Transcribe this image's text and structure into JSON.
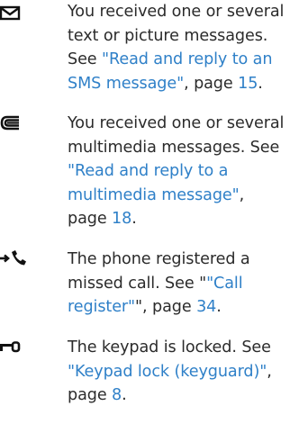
{
  "colors": {
    "text": "#2b2b2b",
    "link": "#2f80c8",
    "icon": "#111111"
  },
  "entries": [
    {
      "icon": "envelope-icon",
      "lines": [
        [
          {
            "t": "You received one or several",
            "k": "plain"
          }
        ],
        [
          {
            "t": "text or picture messages.",
            "k": "plain"
          }
        ],
        [
          {
            "t": "See ",
            "k": "plain"
          },
          {
            "t": "\"Read and reply to an",
            "k": "link"
          }
        ],
        [
          {
            "t": "SMS message\"",
            "k": "link"
          },
          {
            "t": ", page ",
            "k": "plain"
          },
          {
            "t": "15",
            "k": "link"
          },
          {
            "t": ".",
            "k": "plain"
          }
        ]
      ]
    },
    {
      "icon": "multimedia-message-icon",
      "lines": [
        [
          {
            "t": "You received one or several",
            "k": "plain"
          }
        ],
        [
          {
            "t": "multimedia messages. See",
            "k": "plain"
          }
        ],
        [
          {
            "t": "\"Read and reply to a",
            "k": "link"
          }
        ],
        [
          {
            "t": "multimedia message\"",
            "k": "link"
          },
          {
            "t": ",",
            "k": "plain"
          }
        ],
        [
          {
            "t": "page ",
            "k": "plain"
          },
          {
            "t": "18",
            "k": "link"
          },
          {
            "t": ".",
            "k": "plain"
          }
        ]
      ]
    },
    {
      "icon": "missed-call-icon",
      "lines": [
        [
          {
            "t": "The phone registered a",
            "k": "plain"
          }
        ],
        [
          {
            "t": "missed call. See \"",
            "k": "plain"
          },
          {
            "t": "\"Call",
            "k": "link"
          }
        ],
        [
          {
            "t": "register\"",
            "k": "link"
          },
          {
            "t": "\", page ",
            "k": "plain"
          },
          {
            "t": "34",
            "k": "link"
          },
          {
            "t": ".",
            "k": "plain"
          }
        ]
      ]
    },
    {
      "icon": "keypad-lock-icon",
      "lines": [
        [
          {
            "t": "The keypad is locked. See",
            "k": "plain"
          }
        ],
        [
          {
            "t": "\"Keypad lock (keyguard)\"",
            "k": "link"
          },
          {
            "t": ",",
            "k": "plain"
          }
        ],
        [
          {
            "t": "page ",
            "k": "plain"
          },
          {
            "t": "8",
            "k": "link"
          },
          {
            "t": ".",
            "k": "plain"
          }
        ]
      ]
    }
  ]
}
